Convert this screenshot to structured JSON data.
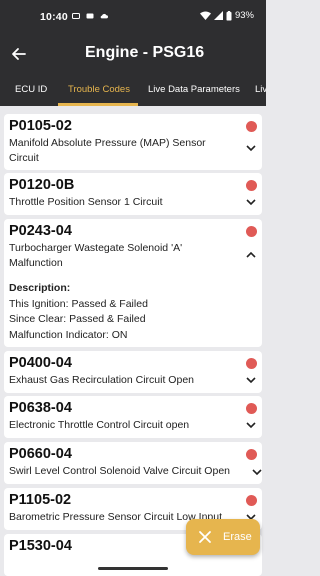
{
  "status_bar": {
    "time": "10:40",
    "battery": "93%"
  },
  "app_bar": {
    "title": "Engine - PSG16"
  },
  "tabs": [
    {
      "label": "ECU ID"
    },
    {
      "label": "Trouble Codes"
    },
    {
      "label": "Live Data Parameters"
    },
    {
      "label": "Live"
    }
  ],
  "active_tab": "Trouble Codes",
  "codes": [
    {
      "code": "P0105-02",
      "line1": "Manifold Absolute Pressure (MAP) Sensor",
      "line2": "Circuit",
      "expanded": false
    },
    {
      "code": "P0120-0B",
      "line1": "Throttle Position Sensor 1 Circuit",
      "line2": "",
      "expanded": false
    },
    {
      "code": "P0243-04",
      "line1": "Turbocharger Wastegate Solenoid 'A'",
      "line2": "Malfunction",
      "expanded": true,
      "details": {
        "heading": "Description:",
        "this_ignition": "This Ignition: Passed & Failed",
        "since_clear": "Since Clear: Passed & Failed",
        "mil": "Malfunction Indicator: ON"
      }
    },
    {
      "code": "P0400-04",
      "line1": "Exhaust Gas Recirculation Circuit Open",
      "line2": "",
      "expanded": false
    },
    {
      "code": "P0638-04",
      "line1": "Electronic Throttle Control Circuit open",
      "line2": "",
      "expanded": false
    },
    {
      "code": "P0660-04",
      "line1": "Swirl Level Control Solenoid Valve Circuit Open",
      "line2": "",
      "expanded": false
    },
    {
      "code": "P1105-02",
      "line1": "Barometric Pressure Sensor Circuit Low Input",
      "line2": "",
      "expanded": false
    },
    {
      "code": "P1530-04",
      "line1": "",
      "line2": "",
      "expanded": false
    }
  ],
  "fab": {
    "label": "Erase"
  },
  "colors": {
    "accent": "#e6b54e",
    "status_dot": "#e05a56",
    "bar": "#2e2e30",
    "background": "#e9e9ec"
  },
  "icons": [
    "back-arrow-icon",
    "chevron-down-icon",
    "chevron-up-icon",
    "close-icon",
    "wifi-icon",
    "battery-icon"
  ]
}
